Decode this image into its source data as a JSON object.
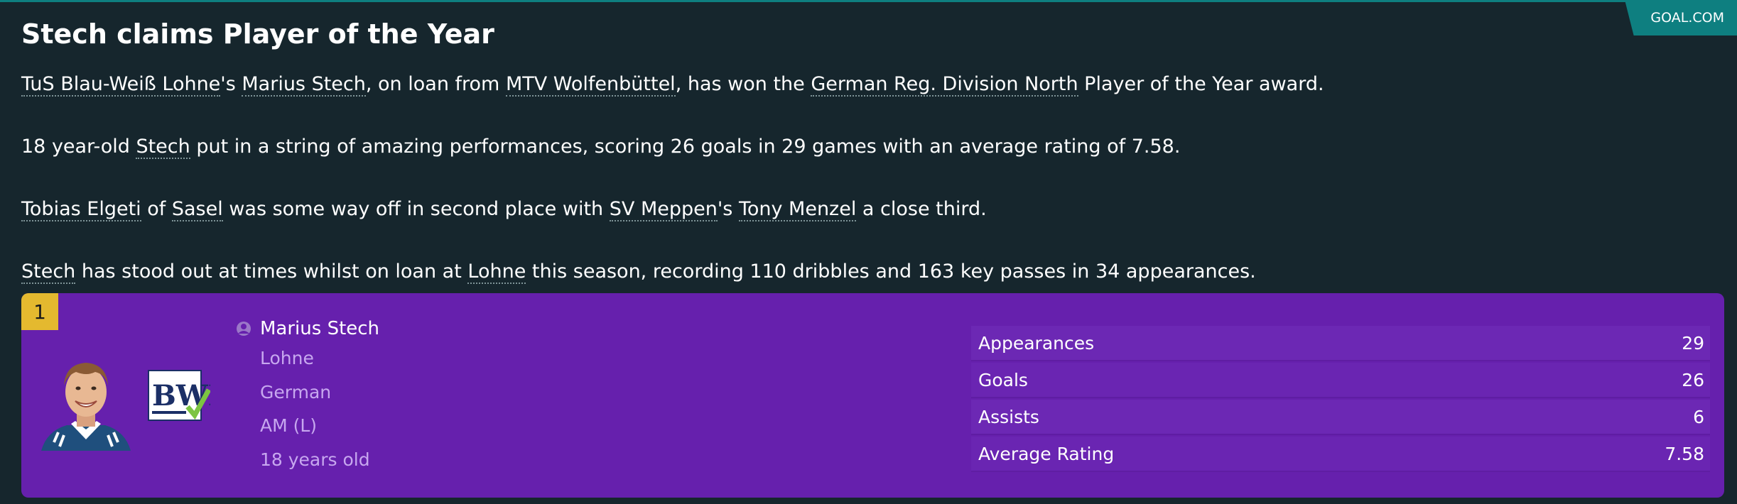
{
  "source": "GOAL.COM",
  "headline": "Stech claims Player of the Year",
  "paragraphs": {
    "p1": {
      "club": "TuS Blau-Weiß Lohne",
      "t1": "'s ",
      "player": "Marius Stech",
      "t2": ", on loan from ",
      "loan_club": "MTV Wolfenbüttel",
      "t3": ", has won the ",
      "competition": "German Reg. Division North",
      "t4": " Player of the Year award."
    },
    "p2": {
      "t1": "18 year-old ",
      "player": "Stech",
      "t2": " put in a string of amazing performances, scoring 26 goals in 29 games with an average rating of 7.58."
    },
    "p3": {
      "second": "Tobias Elgeti",
      "t1": " of ",
      "second_club": "Sasel",
      "t2": " was some way off in second place with ",
      "third_club": "SV Meppen",
      "t3": "'s ",
      "third": "Tony Menzel",
      "t4": " a close third."
    },
    "p4": {
      "player": "Stech",
      "t1": " has stood out at times whilst on loan at ",
      "club": "Lohne",
      "t2": " this season, recording 110 dribbles and 163 key passes in 34 appearances."
    }
  },
  "player_card": {
    "rank": "1",
    "name": "Marius Stech",
    "club": "Lohne",
    "nationality": "German",
    "position": "AM (L)",
    "age": "18 years old",
    "club_logo_text": "BWL",
    "icons": {
      "person": "person-icon",
      "photo": "player-photo",
      "club": "club-badge"
    },
    "colors": {
      "card": "#6620ad",
      "rank_badge": "#e4b92f",
      "accent": "#0e7f80"
    },
    "stats": [
      {
        "label": "Appearances",
        "value": "29"
      },
      {
        "label": "Goals",
        "value": "26"
      },
      {
        "label": "Assists",
        "value": "6"
      },
      {
        "label": "Average Rating",
        "value": "7.58"
      }
    ]
  }
}
